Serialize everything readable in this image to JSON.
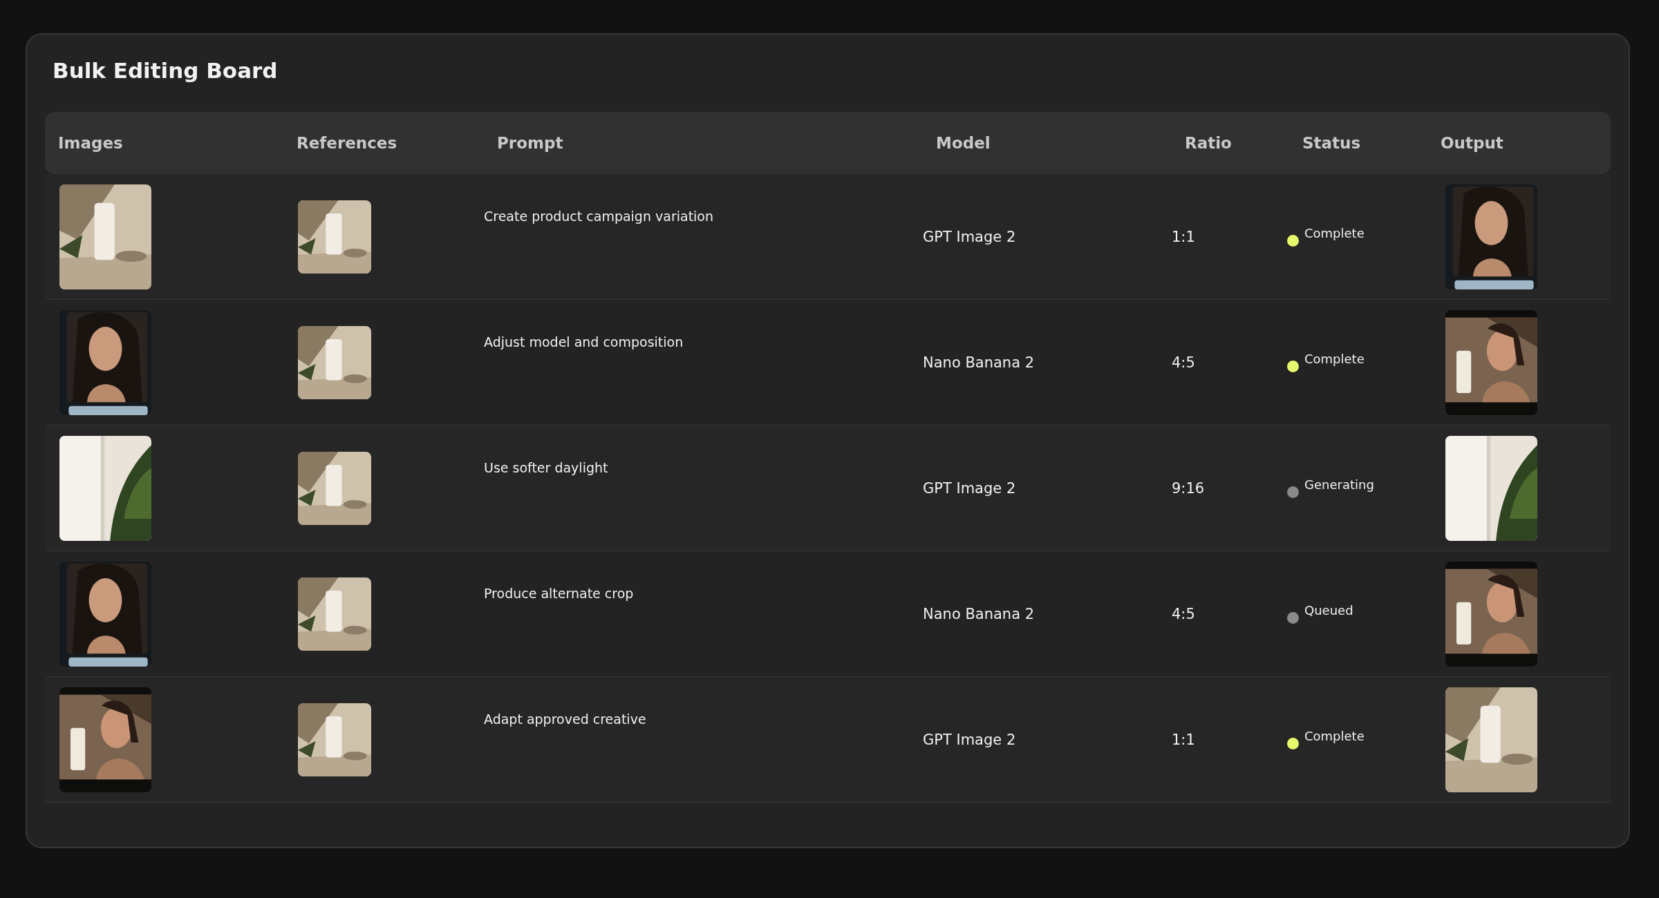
{
  "title": "Bulk Editing Board",
  "columns": [
    "Images",
    "References",
    "Prompt",
    "Model",
    "Ratio",
    "Status",
    "Output"
  ],
  "rows": [
    {
      "prompt": "Create product campaign variation",
      "model": "GPT Image 2",
      "ratio": "1:1",
      "status": "Complete",
      "color": "#e6f86b"
    },
    {
      "prompt": "Adjust model and composition",
      "model": "Nano Banana 2",
      "ratio": "4:5",
      "status": "Complete",
      "color": "#e6f86b"
    },
    {
      "prompt": "Use softer daylight",
      "model": "GPT Image 2",
      "ratio": "9:16",
      "status": "Generating",
      "color": "#8a8a8a"
    },
    {
      "prompt": "Produce alternate crop",
      "model": "Nano Banana 2",
      "ratio": "4:5",
      "status": "Queued",
      "color": "#8a8a8a"
    },
    {
      "prompt": "Adapt approved creative",
      "model": "GPT Image 2",
      "ratio": "1:1",
      "status": "Complete",
      "color": "#e6f86b"
    }
  ]
}
